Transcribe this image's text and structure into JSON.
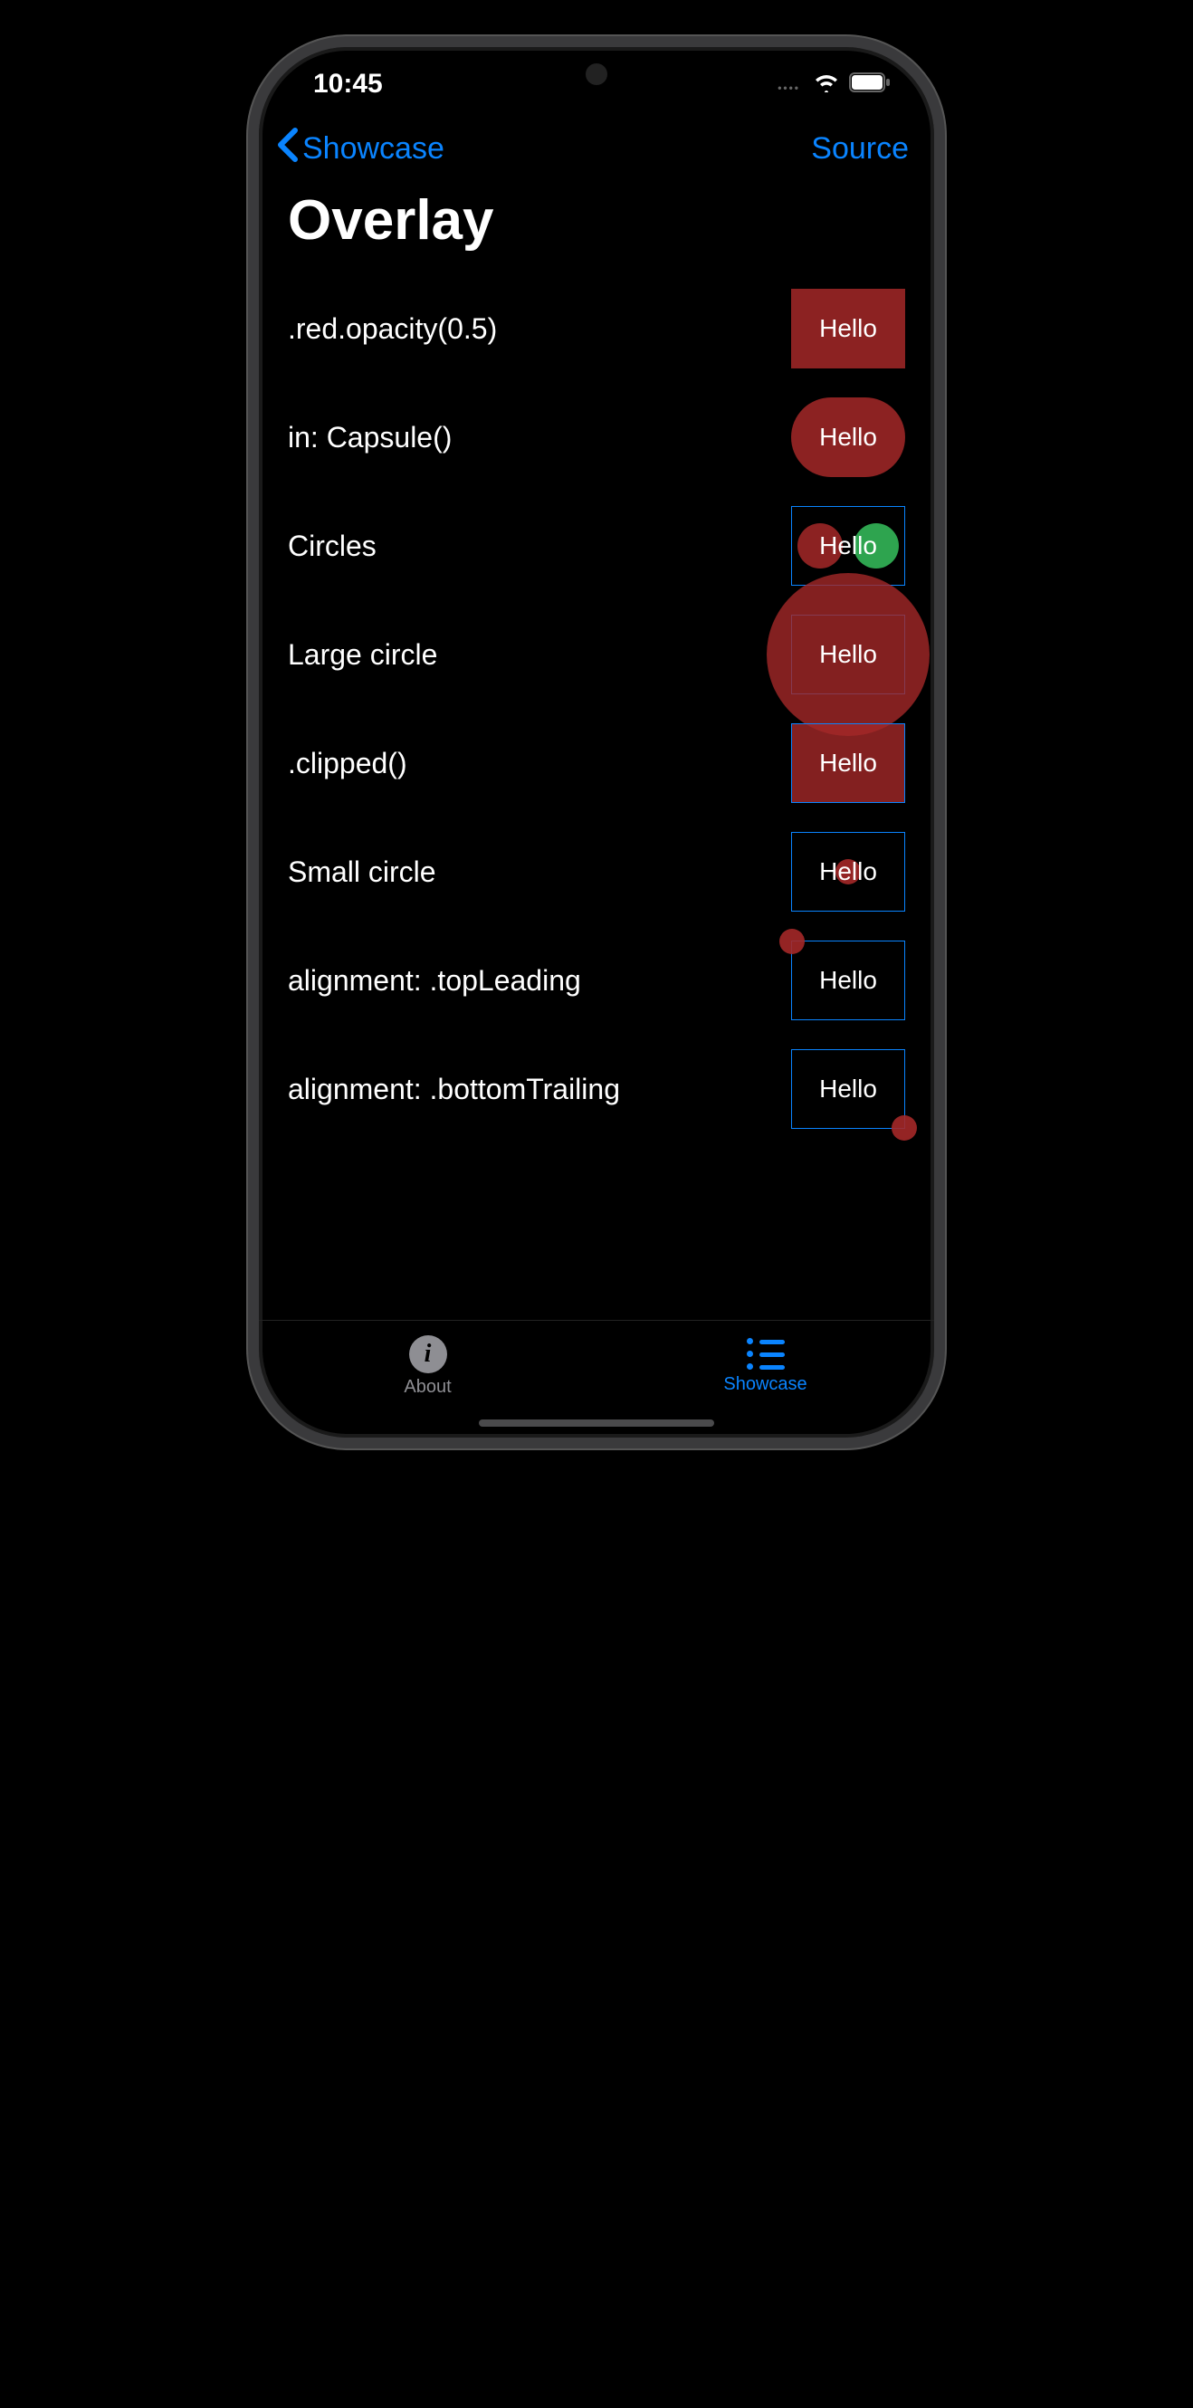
{
  "status": {
    "time": "10:45"
  },
  "nav": {
    "back_label": "Showcase",
    "right_label": "Source"
  },
  "title": "Overlay",
  "rows": {
    "r1": {
      "label": ".red.opacity(0.5)",
      "text": "Hello"
    },
    "r2": {
      "label": "in: Capsule()",
      "text": "Hello"
    },
    "r3": {
      "label": "Circles",
      "text": "Hello"
    },
    "r4": {
      "label": "Large circle",
      "text": "Hello"
    },
    "r5": {
      "label": ".clipped()",
      "text": "Hello"
    },
    "r6": {
      "label": "Small circle",
      "text": "Hello"
    },
    "r7": {
      "label": "alignment: .topLeading",
      "text": "Hello"
    },
    "r8": {
      "label": "alignment: .bottomTrailing",
      "text": "Hello"
    }
  },
  "tabs": {
    "about": "About",
    "showcase": "Showcase"
  }
}
